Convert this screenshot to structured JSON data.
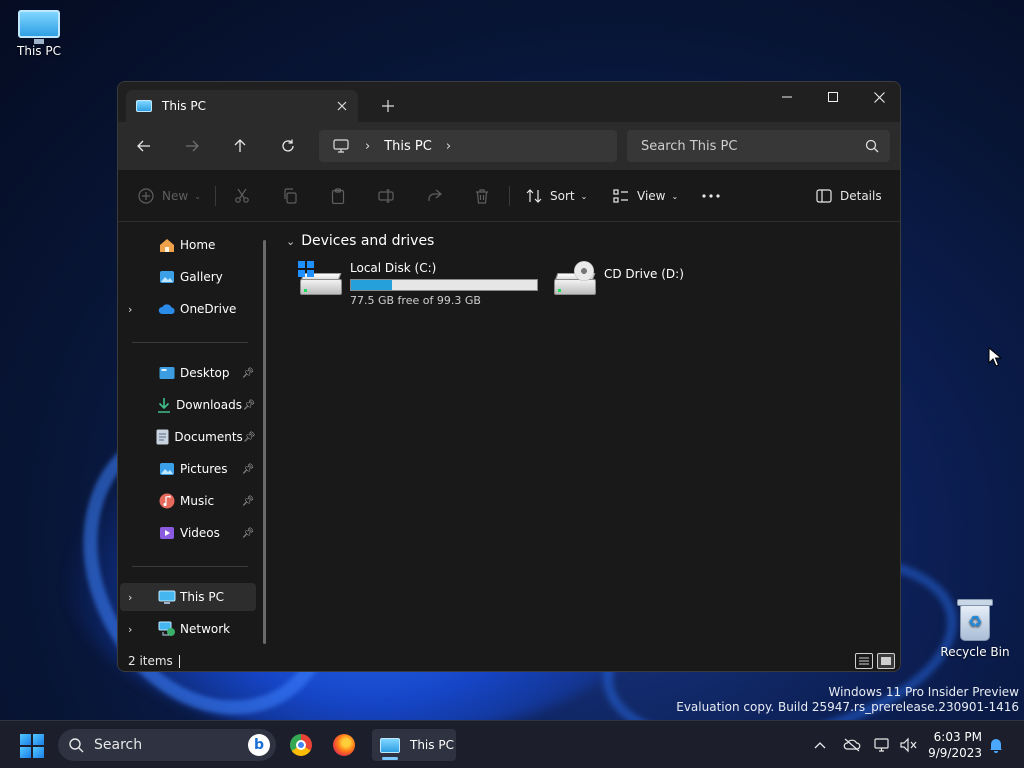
{
  "desktop": {
    "icons": [
      {
        "label": "This PC",
        "icon": "monitor-icon"
      },
      {
        "label": "Recycle Bin",
        "icon": "recycle-bin-icon"
      }
    ],
    "watermark": {
      "line1": "Windows 11 Pro Insider Preview",
      "line2": "Evaluation copy. Build 25947.rs_prerelease.230901-1416"
    }
  },
  "window": {
    "tab_title": "This PC",
    "controls": {
      "minimize": "minimize-icon",
      "maximize": "maximize-icon",
      "close": "close-icon"
    },
    "address": {
      "crumb": "This PC"
    },
    "search": {
      "placeholder": "Search This PC"
    },
    "toolbar": {
      "new_label": "New",
      "sort_label": "Sort",
      "view_label": "View",
      "details_label": "Details"
    },
    "sidebar": {
      "home": "Home",
      "gallery": "Gallery",
      "onedrive": "OneDrive",
      "desktop": "Desktop",
      "downloads": "Downloads",
      "documents": "Documents",
      "pictures": "Pictures",
      "music": "Music",
      "videos": "Videos",
      "thispc": "This PC",
      "network": "Network"
    },
    "content": {
      "group_title": "Devices and drives",
      "drives": [
        {
          "name": "Local Disk (C:)",
          "free_text": "77.5 GB free of 99.3 GB",
          "used_fraction": 0.22
        },
        {
          "name": "CD Drive (D:)"
        }
      ]
    },
    "status": {
      "item_count": "2 items"
    }
  },
  "taskbar": {
    "search_label": "Search",
    "active_app_label": "This PC",
    "clock": {
      "time": "6:03 PM",
      "date": "9/9/2023"
    }
  }
}
